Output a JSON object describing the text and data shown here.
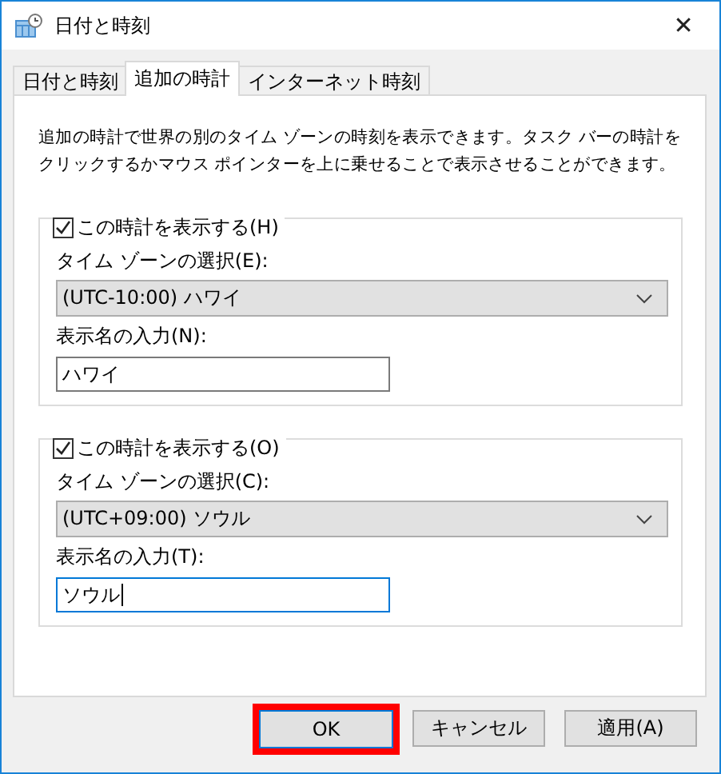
{
  "window": {
    "title": "日付と時刻",
    "close": "✕"
  },
  "tabs": [
    {
      "label": "日付と時刻",
      "selected": false
    },
    {
      "label": "追加の時計",
      "selected": true
    },
    {
      "label": "インターネット時刻",
      "selected": false
    }
  ],
  "description": "追加の時計で世界の別のタイム ゾーンの時刻を表示できます。タスク バーの時計をクリックするかマウス ポインターを上に乗せることで表示させることができます。",
  "clocks": [
    {
      "show_label": "この時計を表示する(H)",
      "checked": true,
      "timezone_label": "タイム ゾーンの選択(E):",
      "timezone": "(UTC-10:00) ハワイ",
      "name_label": "表示名の入力(N):",
      "name": "ハワイ",
      "focused": false
    },
    {
      "show_label": "この時計を表示する(O)",
      "checked": true,
      "timezone_label": "タイム ゾーンの選択(C):",
      "timezone": "(UTC+09:00) ソウル",
      "name_label": "表示名の入力(T):",
      "name": "ソウル",
      "focused": true
    }
  ],
  "buttons": [
    {
      "label": "OK",
      "highlighted": true
    },
    {
      "label": "キャンセル",
      "highlighted": false
    },
    {
      "label": "適用(A)",
      "highlighted": false
    }
  ]
}
